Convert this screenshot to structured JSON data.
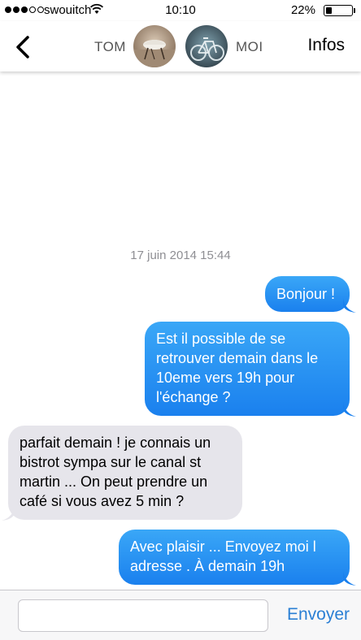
{
  "status_bar": {
    "carrier": "swouitch",
    "time": "10:10",
    "battery_percent": "22%",
    "battery_level": 0.22,
    "signal_bars_filled": 3,
    "signal_bars_total": 5
  },
  "nav": {
    "back_icon": "chevron-left-icon",
    "contact_name": "TOM",
    "self_name": "MOI",
    "infos_label": "Infos"
  },
  "conversation": {
    "timestamp": "17 juin 2014 15:44",
    "messages": [
      {
        "direction": "outgoing",
        "text": "Bonjour !"
      },
      {
        "direction": "outgoing",
        "text": "Est il possible de se retrouver demain dans le 10eme vers 19h pour l'échange ?"
      },
      {
        "direction": "incoming",
        "text": "parfait demain ! je connais un bistrot sympa sur le canal st martin ... On peut prendre un café si vous avez 5 min ?"
      },
      {
        "direction": "outgoing",
        "text": "Avec plaisir ... Envoyez moi l adresse . À demain 19h"
      }
    ]
  },
  "composer": {
    "input_value": "",
    "input_placeholder": "",
    "send_label": "Envoyer"
  },
  "colors": {
    "outgoing_bubble": "#1a80ee",
    "incoming_bubble": "#e6e5eb",
    "accent": "#2a7fd4"
  }
}
